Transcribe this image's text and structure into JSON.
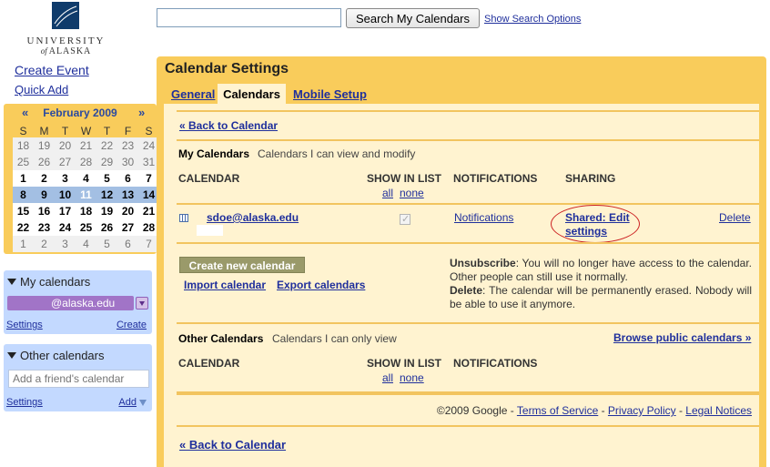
{
  "logo": {
    "line1": "UNIVERSITY",
    "of": "of",
    "line2": "ALASKA"
  },
  "search": {
    "value": "",
    "button_label": "Search My Calendars",
    "options_link": "Show Search Options"
  },
  "left": {
    "create_event": "Create Event",
    "quick_add": "Quick Add"
  },
  "mini_calendar": {
    "month": "February 2009",
    "prev": "«",
    "next": "»",
    "weekdays": [
      "S",
      "M",
      "T",
      "W",
      "T",
      "F",
      "S"
    ],
    "weeks": [
      [
        "18",
        "19",
        "20",
        "21",
        "22",
        "23",
        "24"
      ],
      [
        "25",
        "26",
        "27",
        "28",
        "29",
        "30",
        "31"
      ],
      [
        "1",
        "2",
        "3",
        "4",
        "5",
        "6",
        "7"
      ],
      [
        "8",
        "9",
        "10",
        "11",
        "12",
        "13",
        "14"
      ],
      [
        "15",
        "16",
        "17",
        "18",
        "19",
        "20",
        "21"
      ],
      [
        "22",
        "23",
        "24",
        "25",
        "26",
        "27",
        "28"
      ],
      [
        "1",
        "2",
        "3",
        "4",
        "5",
        "6",
        "7"
      ]
    ],
    "today": "11"
  },
  "my_calendars": {
    "title": "My calendars",
    "item_label": "@alaska.edu",
    "settings": "Settings",
    "create": "Create",
    "item_color": "#a174c7"
  },
  "other_calendars": {
    "title": "Other calendars",
    "placeholder": "Add a friend's calendar",
    "settings": "Settings",
    "add": "Add"
  },
  "settings": {
    "title": "Calendar Settings",
    "tabs": {
      "general": "General",
      "calendars": "Calendars",
      "mobile": "Mobile Setup"
    },
    "back_link": "« Back to Calendar",
    "my_calendars": {
      "heading": "My Calendars",
      "subheading": "Calendars I can view and modify"
    },
    "columns": {
      "calendar": "CALENDAR",
      "show_in_list": "SHOW IN LIST",
      "all": "all",
      "none": "none",
      "notifications": "NOTIFICATIONS",
      "sharing": "SHARING"
    },
    "row": {
      "email": "sdoe@alaska.edu",
      "show_in_list": true,
      "notifications": "Notifications",
      "sharing_line1": "Shared: Edit",
      "sharing_line2": "settings",
      "delete": "Delete"
    },
    "create_button": "Create new calendar",
    "import": "Import calendar",
    "export": "Export calendars",
    "unsubscribe_label": "Unsubscribe",
    "unsubscribe_text": ": You will no longer have access to the calendar. Other people can still use it normally.",
    "delete_label": "Delete",
    "delete_text": ": The calendar will be permanently erased. Nobody will be able to use it anymore.",
    "other_calendars": {
      "heading": "Other Calendars",
      "subheading": "Calendars I can only view",
      "browse": "Browse public calendars »"
    },
    "footer": {
      "copyright": "©2009 Google",
      "sep": " - ",
      "terms": "Terms of Service",
      "privacy": "Privacy Policy",
      "legal": "Legal Notices"
    }
  },
  "colors": {
    "accent_yellow": "#f9cc5b",
    "panel_blue": "#c3d9ff",
    "link_blue": "#1f2f9c",
    "highlight_red": "#cc2222"
  }
}
